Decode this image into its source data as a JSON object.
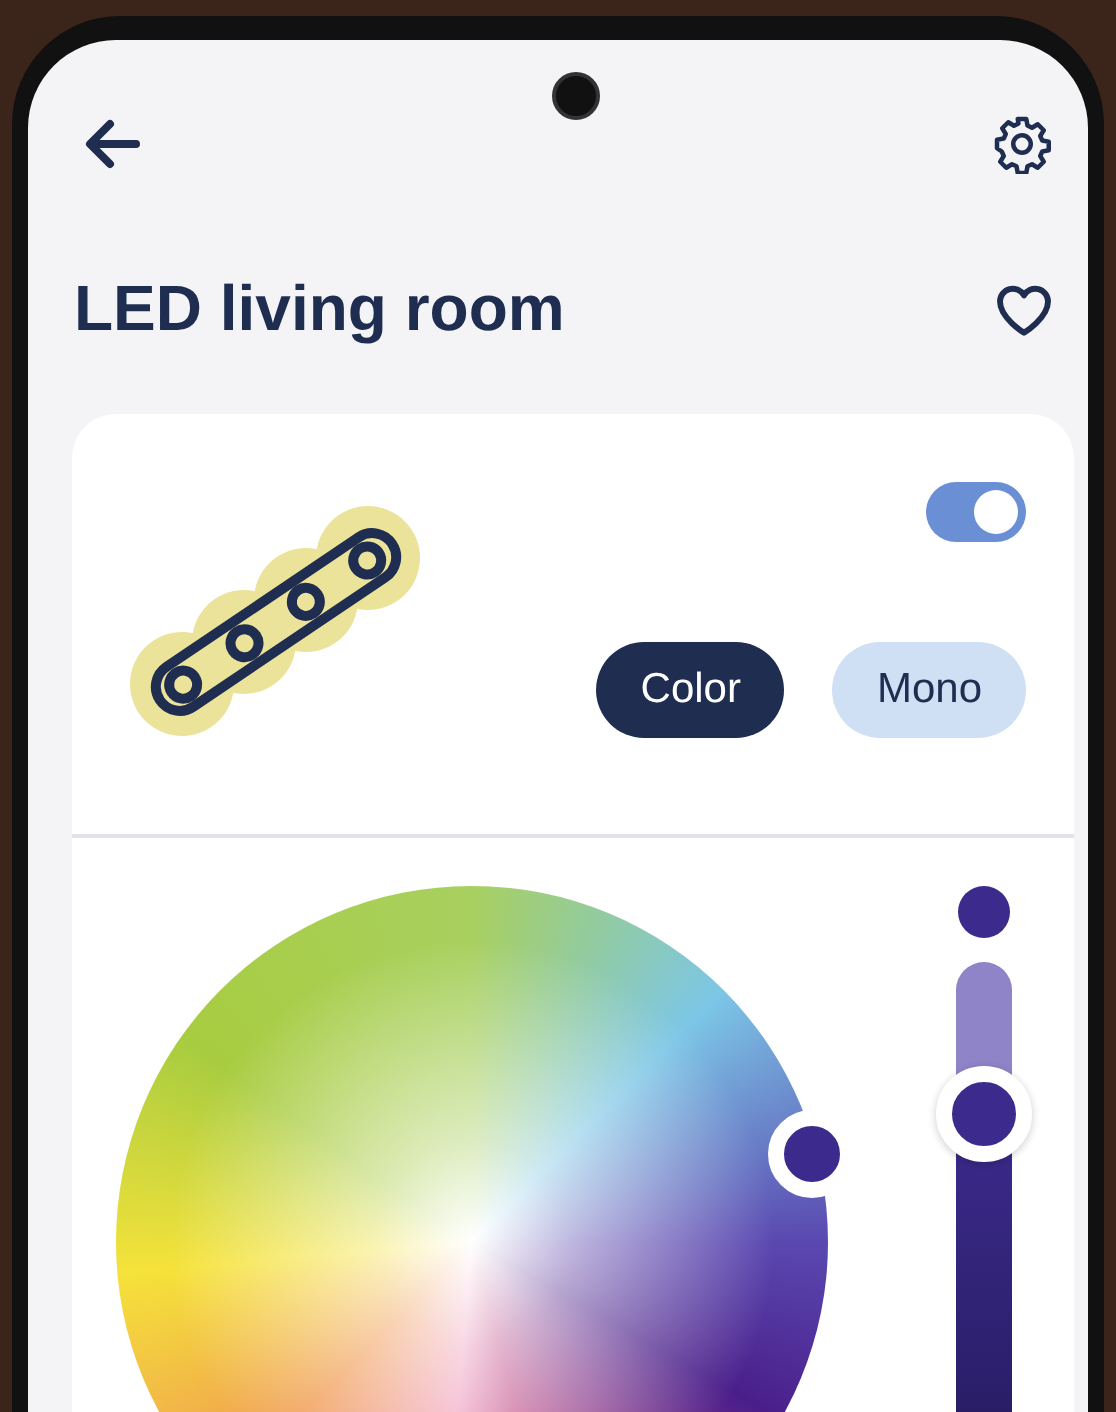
{
  "screen": {
    "title": "LED living room",
    "favorite": false
  },
  "device": {
    "on": true,
    "modes": [
      {
        "label": "Color",
        "selected": true
      },
      {
        "label": "Mono",
        "selected": false
      }
    ]
  },
  "brightness": {
    "level": 0.7
  }
}
